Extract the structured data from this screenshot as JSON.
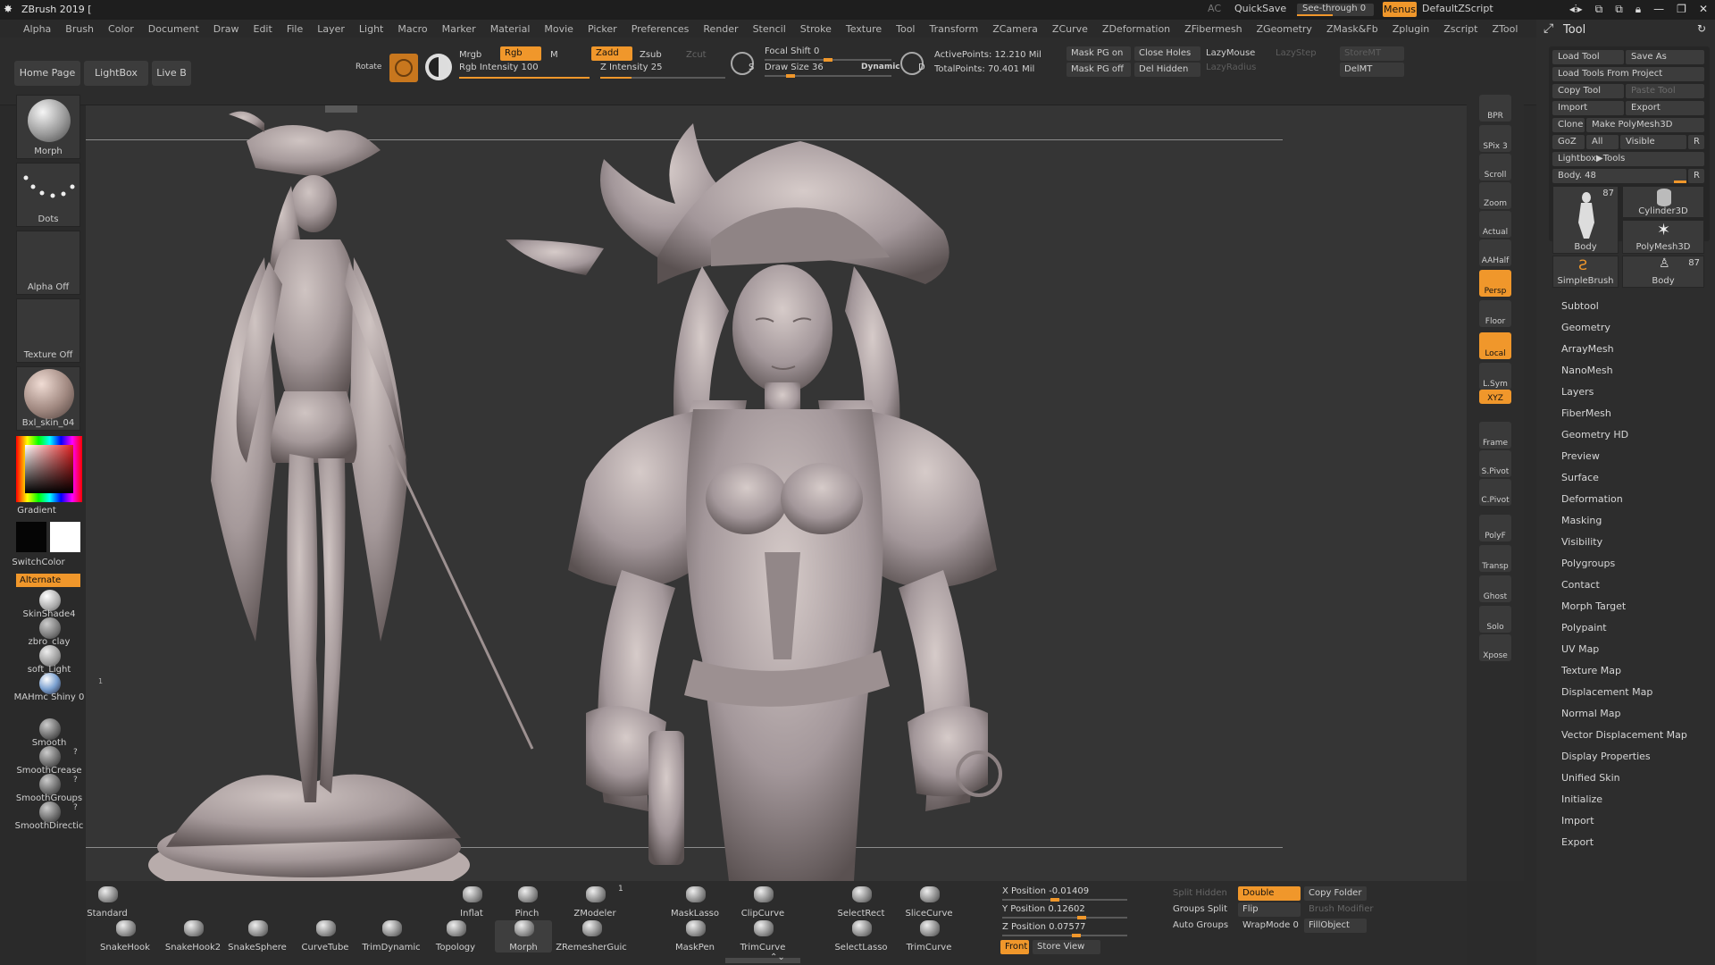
{
  "app": {
    "title": "ZBrush 2019 [",
    "ac_label": "AC",
    "quicksave": "QuickSave",
    "see_through": "See-through  0",
    "see_through_value": 0,
    "menus": "Menus",
    "script": "DefaultZScript"
  },
  "menubar": [
    "Alpha",
    "Brush",
    "Color",
    "Document",
    "Draw",
    "Edit",
    "File",
    "Layer",
    "Light",
    "Macro",
    "Marker",
    "Material",
    "Movie",
    "Picker",
    "Preferences",
    "Render",
    "Stencil",
    "Stroke",
    "Texture",
    "Tool",
    "Transform",
    "ZCamera",
    "ZCurve",
    "ZDeformation",
    "ZFibermesh",
    "ZGeometry",
    "ZMask&Fb",
    "Zplugin",
    "Zscript",
    "ZTool"
  ],
  "shelf": {
    "home_page": "Home Page",
    "lightbox": "LightBox",
    "live_boolean": "Live B",
    "rotate": "Rotate",
    "mrgb": "Mrgb",
    "rgb": "Rgb",
    "m": "M",
    "zadd": "Zadd",
    "zsub": "Zsub",
    "zcut": "Zcut",
    "rgb_intensity": "Rgb Intensity 100",
    "rgb_intensity_value": 100,
    "z_intensity": "Z Intensity 25",
    "z_intensity_value": 25,
    "focal_shift": "Focal Shift 0",
    "focal_shift_value": 0,
    "draw_size": "Draw Size 36",
    "draw_size_value": 36,
    "dynamic": "Dynamic",
    "active_points": "ActivePoints: 12.210 Mil",
    "total_points": "TotalPoints: 70.401 Mil",
    "mask_pg_on": "Mask PG on",
    "mask_pg_off": "Mask PG off",
    "close_holes": "Close Holes",
    "del_hidden": "Del Hidden",
    "lazymouse": "LazyMouse",
    "lazystep": "LazyStep",
    "lazyradius": "LazyRadius",
    "storemt": "StoreMT",
    "delmt": "DelMT"
  },
  "left_tray": {
    "brush": "Morph",
    "stroke": "Dots",
    "alpha": "Alpha Off",
    "texture": "Texture Off",
    "material": "Bxl_skin_04",
    "gradient": "Gradient",
    "switch_color": "SwitchColor",
    "alternate": "Alternate",
    "materials": [
      "SkinShade4",
      "zbro_clay",
      "soft_Light",
      "MAHmc Shiny 0"
    ],
    "smooth_brushes": [
      {
        "name": "Smooth",
        "key": ""
      },
      {
        "name": "SmoothCrease",
        "key": "?"
      },
      {
        "name": "SmoothGroups",
        "key": "?"
      },
      {
        "name": "SmoothDirectic",
        "key": "?"
      }
    ]
  },
  "right_shelf": [
    {
      "name": "bpr",
      "label": "BPR",
      "orange": false
    },
    {
      "name": "spix",
      "label": "SPix 3",
      "orange": false
    },
    {
      "name": "scroll",
      "label": "Scroll",
      "orange": false
    },
    {
      "name": "zoom",
      "label": "Zoom",
      "orange": false
    },
    {
      "name": "actual",
      "label": "Actual",
      "orange": false
    },
    {
      "name": "aahalf",
      "label": "AAHalf",
      "orange": false
    },
    {
      "name": "persp",
      "label": "Persp",
      "orange": true
    },
    {
      "name": "floor",
      "label": "Floor",
      "orange": false
    },
    {
      "name": "local",
      "label": "Local",
      "orange": true
    },
    {
      "name": "lsym",
      "label": "L.Sym",
      "orange": false
    },
    {
      "name": "xyz",
      "label": "XYZ",
      "orange": true
    },
    {
      "name": "frame",
      "label": "Frame",
      "orange": false
    },
    {
      "name": "spivot",
      "label": "S.Pivot",
      "orange": false
    },
    {
      "name": "cpivot",
      "label": "C.Pivot",
      "orange": false
    },
    {
      "name": "polyf",
      "label": "PolyF",
      "orange": false
    },
    {
      "name": "transp",
      "label": "Transp",
      "orange": false
    },
    {
      "name": "ghost",
      "label": "Ghost",
      "orange": false
    },
    {
      "name": "solo",
      "label": "Solo",
      "orange": false
    },
    {
      "name": "xpose",
      "label": "Xpose",
      "orange": false
    }
  ],
  "tool_panel": {
    "title": "Tool",
    "load_tool": "Load Tool",
    "save_as": "Save As",
    "load_from_project": "Load Tools From Project",
    "copy_tool": "Copy Tool",
    "paste_tool": "Paste Tool",
    "import": "Import",
    "export": "Export",
    "clone": "Clone",
    "make_polymesh": "Make PolyMesh3D",
    "goz": "GoZ",
    "all": "All",
    "visible": "Visible",
    "r": "R",
    "lightbox_tools": "Lightbox▶Tools",
    "body_slider": "Body. 48",
    "body_slider_value": 48,
    "thumbs": [
      {
        "name": "Body",
        "count": "87"
      },
      {
        "name": "Cylinder3D",
        "count": ""
      },
      {
        "name": "PolyMesh3D",
        "count": ""
      },
      {
        "name": "SimpleBrush",
        "count": ""
      },
      {
        "name": "Body",
        "count": "87"
      }
    ],
    "subpalettes": [
      "Subtool",
      "Geometry",
      "ArrayMesh",
      "NanoMesh",
      "Layers",
      "FiberMesh",
      "Geometry HD",
      "Preview",
      "Surface",
      "Deformation",
      "Masking",
      "Visibility",
      "Polygroups",
      "Contact",
      "Morph Target",
      "Polypaint",
      "UV Map",
      "Texture Map",
      "Displacement Map",
      "Normal Map",
      "Vector Displacement Map",
      "Display Properties",
      "Unified Skin",
      "Initialize",
      "Import",
      "Export"
    ]
  },
  "bottom_tray": {
    "brushes_top": [
      "Standard",
      "Inflat",
      "Pinch",
      "ZModeler",
      "MaskLasso",
      "ClipCurve",
      "SelectRect",
      "SliceCurve"
    ],
    "brushes_bottom": [
      "SnakeHook",
      "SnakeHook2",
      "SnakeSphere",
      "CurveTube",
      "TrimDynamic",
      "Topology",
      "Morph",
      "ZRemesherGuic",
      "MaskPen",
      "TrimCurve",
      "SelectLasso",
      "TrimCurve"
    ],
    "zmodeler_key": "1",
    "x_position": "X Position -0.01409",
    "x_position_value": -0.01409,
    "y_position": "Y Position 0.12602",
    "y_position_value": 0.12602,
    "z_position": "Z Position 0.07577",
    "z_position_value": 0.07577,
    "front": "Front",
    "store_view": "Store View",
    "split_hidden": "Split Hidden",
    "double": "Double",
    "copy_folder": "Copy Folder",
    "groups_split": "Groups Split",
    "flip": "Flip",
    "brush_modifier": "Brush Modifier",
    "auto_groups": "Auto Groups",
    "wrapmode": "WrapMode 0",
    "fillobject": "FillObject"
  },
  "colors": {
    "accent": "#f0972b",
    "panel": "#2c2c2c",
    "viewport": "#353535",
    "clay": "#a89d9b"
  }
}
